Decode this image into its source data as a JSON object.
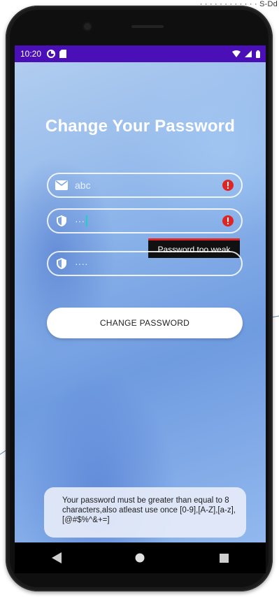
{
  "top_snippet": "· · · · · · · · · · · ·  S-Dd",
  "status_bar": {
    "time": "10:20"
  },
  "screen": {
    "title": "Change Your Password",
    "email_field": {
      "value": "abc"
    },
    "password_field": {
      "value": "···"
    },
    "confirm_field": {
      "value": "····"
    },
    "tooltip": "Password too weak",
    "button_label": "CHANGE PASSWORD",
    "info_text": "Your password must be greater than equal to 8 characters,also atleast use once [0-9],[A-Z],[a-z],[@#$%^&+=]"
  },
  "colors": {
    "status_bar": "#4b0fb8",
    "error": "#e02424",
    "cursor": "#19d3c5"
  },
  "icons": {
    "status": [
      "data-saver-icon",
      "sd-card-icon",
      "wifi-icon",
      "signal-icon",
      "battery-icon"
    ],
    "fields": [
      "mail-icon",
      "shield-icon",
      "shield-icon"
    ],
    "error": "error-circle-icon",
    "nav": [
      "back-icon",
      "home-icon",
      "recents-icon"
    ]
  }
}
